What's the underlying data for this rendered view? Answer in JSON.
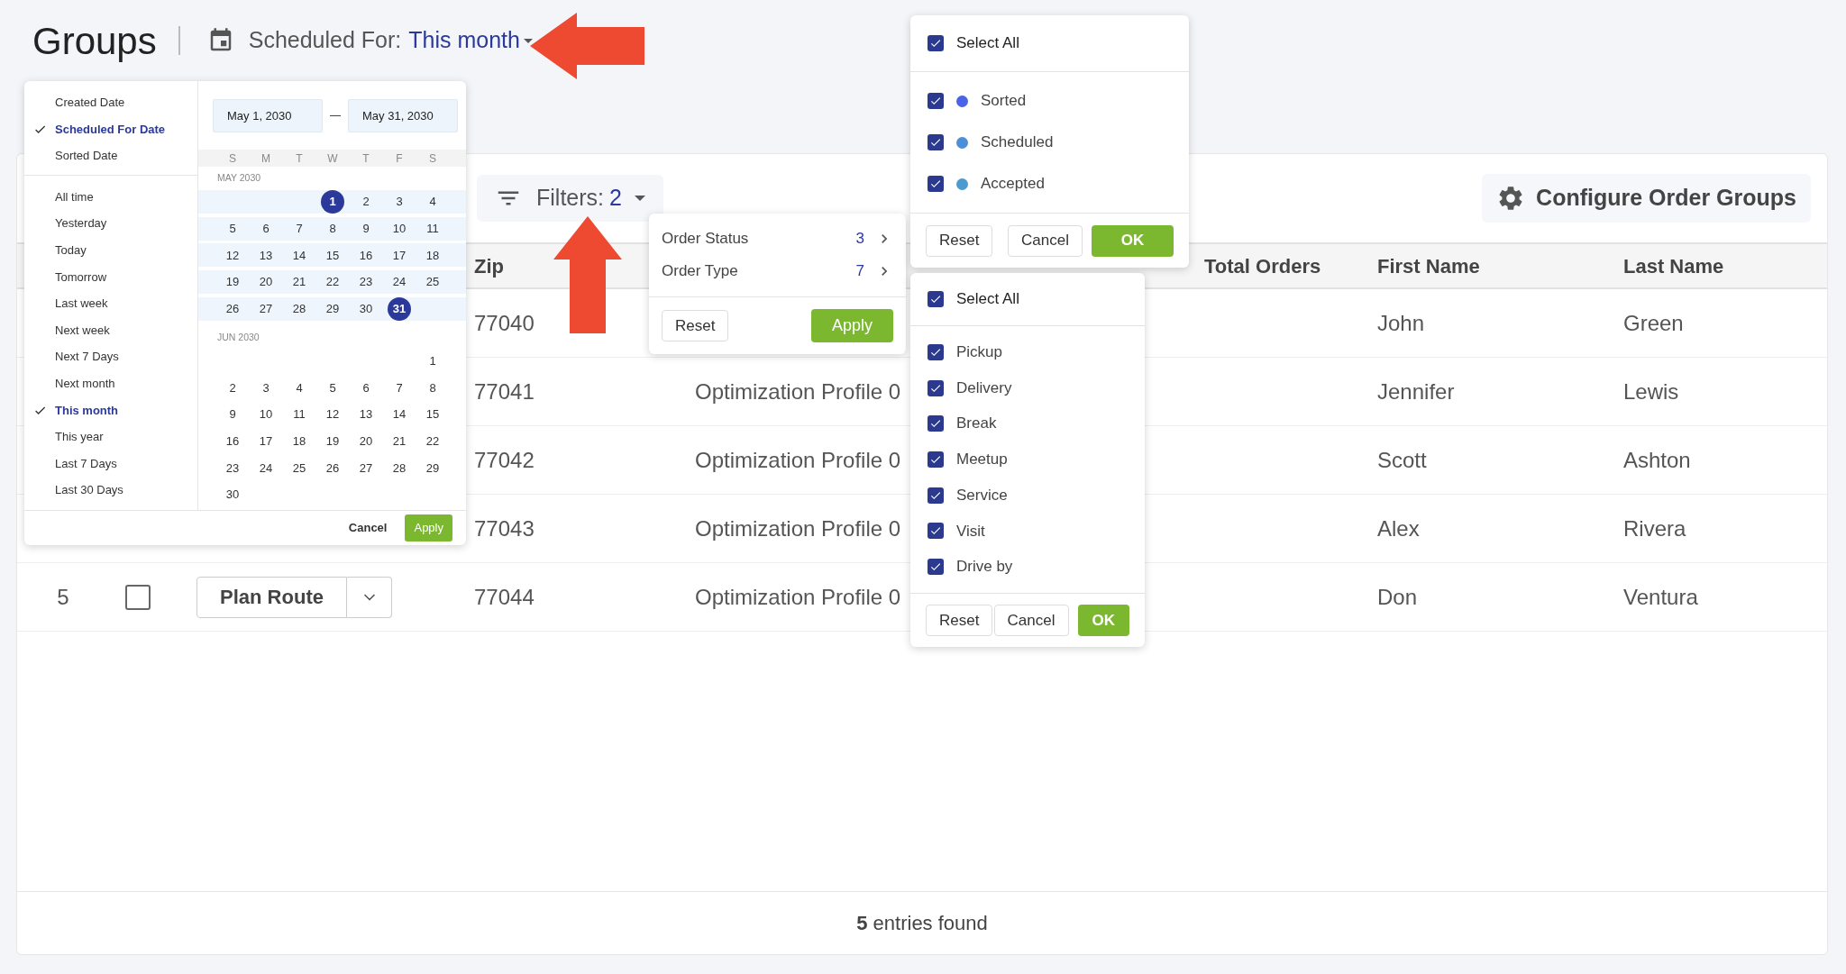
{
  "header": {
    "title": "Groups",
    "scheduled_label": "Scheduled For:",
    "scheduled_value": "This month"
  },
  "toolbar": {
    "filters_label": "Filters:",
    "filters_count": "2",
    "configure_label": "Configure Order Groups"
  },
  "table": {
    "headers": {
      "zip": "Zip",
      "total_orders": "Total Orders",
      "first_name": "First Name",
      "last_name": "Last Name"
    },
    "rows": [
      {
        "zip": "77040",
        "first_name": "John",
        "last_name": "Green"
      },
      {
        "zip": "77041",
        "profile": "Optimization Profile 0",
        "first_name": "Jennifer",
        "last_name": "Lewis"
      },
      {
        "zip": "77042",
        "profile": "Optimization Profile 0",
        "first_name": "Scott",
        "last_name": "Ashton"
      },
      {
        "zip": "77043",
        "profile": "Optimization Profile 0",
        "first_name": "Alex",
        "last_name": "Rivera"
      },
      {
        "number": "5",
        "checked": false,
        "plan_route": "Plan Route",
        "zip": "77044",
        "profile": "Optimization Profile 0",
        "first_name": "Don",
        "last_name": "Ventura"
      }
    ],
    "footer": "**5** entries found"
  },
  "date_menu": {
    "date_types": [
      {
        "label": "Created Date",
        "selected": false
      },
      {
        "label": "Scheduled For Date",
        "selected": true
      },
      {
        "label": "Sorted Date",
        "selected": false
      }
    ],
    "ranges": [
      {
        "label": "All time",
        "selected": false
      },
      {
        "label": "Yesterday",
        "selected": false
      },
      {
        "label": "Today",
        "selected": false
      },
      {
        "label": "Tomorrow",
        "selected": false
      },
      {
        "label": "Last week",
        "selected": false
      },
      {
        "label": "Next week",
        "selected": false
      },
      {
        "label": "Next 7 Days",
        "selected": false
      },
      {
        "label": "Next month",
        "selected": false
      },
      {
        "label": "This month",
        "selected": true
      },
      {
        "label": "This year",
        "selected": false
      },
      {
        "label": "Last 7 Days",
        "selected": false
      },
      {
        "label": "Last 30 Days",
        "selected": false
      }
    ],
    "start_date": "May 1, 2030",
    "end_date": "May 31, 2030",
    "weekdays": [
      "S",
      "M",
      "T",
      "W",
      "T",
      "F",
      "S"
    ],
    "months": [
      {
        "label": "MAY 2030",
        "in_range": true,
        "weeks": [
          [
            {
              "d": "1",
              "selected": true
            },
            {
              "d": "2",
              "selected": false
            },
            {
              "d": "3",
              "selected": false
            },
            {
              "d": "4",
              "selected": false
            }
          ],
          [
            {
              "d": "5",
              "selected": false
            },
            {
              "d": "6",
              "selected": false
            },
            {
              "d": "7",
              "selected": false
            },
            {
              "d": "8",
              "selected": false
            },
            {
              "d": "9",
              "selected": false
            },
            {
              "d": "10",
              "selected": false
            },
            {
              "d": "11",
              "selected": false
            }
          ],
          [
            {
              "d": "12",
              "selected": false
            },
            {
              "d": "13",
              "selected": false
            },
            {
              "d": "14",
              "selected": false
            },
            {
              "d": "15",
              "selected": false
            },
            {
              "d": "16",
              "selected": false
            },
            {
              "d": "17",
              "selected": false
            },
            {
              "d": "18",
              "selected": false
            }
          ],
          [
            {
              "d": "19",
              "selected": false
            },
            {
              "d": "20",
              "selected": false
            },
            {
              "d": "21",
              "selected": false
            },
            {
              "d": "22",
              "selected": false
            },
            {
              "d": "23",
              "selected": false
            },
            {
              "d": "24",
              "selected": false
            },
            {
              "d": "25",
              "selected": false
            }
          ],
          [
            {
              "d": "26",
              "selected": false
            },
            {
              "d": "27",
              "selected": false
            },
            {
              "d": "28",
              "selected": false
            },
            {
              "d": "29",
              "selected": false
            },
            {
              "d": "30",
              "selected": false
            },
            {
              "d": "31",
              "selected": true
            }
          ]
        ]
      },
      {
        "label": "JUN 2030",
        "in_range": false,
        "weeks": [
          [
            {
              "d": "1",
              "selected": false
            }
          ],
          [
            {
              "d": "2",
              "selected": false
            },
            {
              "d": "3",
              "selected": false
            },
            {
              "d": "4",
              "selected": false
            },
            {
              "d": "5",
              "selected": false
            },
            {
              "d": "6",
              "selected": false
            },
            {
              "d": "7",
              "selected": false
            },
            {
              "d": "8",
              "selected": false
            }
          ],
          [
            {
              "d": "9",
              "selected": false
            },
            {
              "d": "10",
              "selected": false
            },
            {
              "d": "11",
              "selected": false
            },
            {
              "d": "12",
              "selected": false
            },
            {
              "d": "13",
              "selected": false
            },
            {
              "d": "14",
              "selected": false
            },
            {
              "d": "15",
              "selected": false
            }
          ],
          [
            {
              "d": "16",
              "selected": false
            },
            {
              "d": "17",
              "selected": false
            },
            {
              "d": "18",
              "selected": false
            },
            {
              "d": "19",
              "selected": false
            },
            {
              "d": "20",
              "selected": false
            },
            {
              "d": "21",
              "selected": false
            },
            {
              "d": "22",
              "selected": false
            }
          ],
          [
            {
              "d": "23",
              "selected": false
            },
            {
              "d": "24",
              "selected": false
            },
            {
              "d": "25",
              "selected": false
            },
            {
              "d": "26",
              "selected": false
            },
            {
              "d": "27",
              "selected": false
            },
            {
              "d": "28",
              "selected": false
            },
            {
              "d": "29",
              "selected": false
            }
          ],
          [
            {
              "d": "30",
              "selected": false
            }
          ]
        ]
      }
    ],
    "cancel": "Cancel",
    "apply": "Apply"
  },
  "filters_menu": {
    "items": [
      {
        "label": "Order Status",
        "count": "3"
      },
      {
        "label": "Order Type",
        "count": "7"
      }
    ],
    "reset": "Reset",
    "apply": "Apply"
  },
  "status_menu": {
    "select_all": {
      "label": "Select All",
      "checked": true
    },
    "items": [
      {
        "label": "Sorted",
        "checked": true,
        "color": "#4a63e8"
      },
      {
        "label": "Scheduled",
        "checked": true,
        "color": "#4a8fd8"
      },
      {
        "label": "Accepted",
        "checked": true,
        "color": "#4b9bd0"
      }
    ],
    "reset": "Reset",
    "cancel": "Cancel",
    "ok": "OK"
  },
  "type_menu": {
    "select_all": {
      "label": "Select All",
      "checked": true
    },
    "items": [
      {
        "label": "Pickup",
        "checked": true
      },
      {
        "label": "Delivery",
        "checked": true
      },
      {
        "label": "Break",
        "checked": true
      },
      {
        "label": "Meetup",
        "checked": true
      },
      {
        "label": "Service",
        "checked": true
      },
      {
        "label": "Visit",
        "checked": true
      },
      {
        "label": "Drive by",
        "checked": true
      }
    ],
    "reset": "Reset",
    "cancel": "Cancel",
    "ok": "OK"
  }
}
